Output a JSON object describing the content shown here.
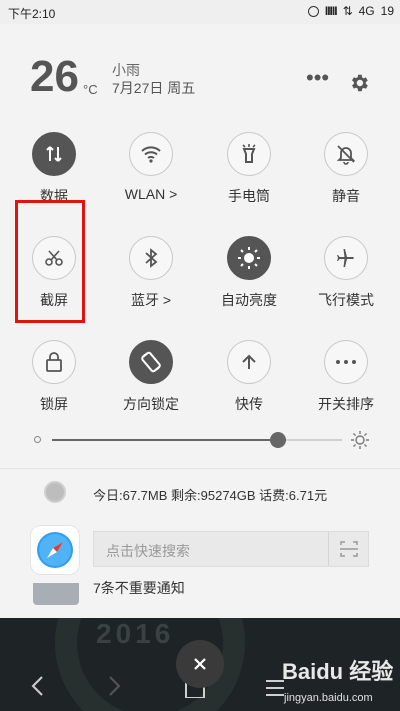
{
  "statusbar": {
    "time": "下午2:10",
    "network": "4G",
    "battery": "19"
  },
  "weather": {
    "temp": "26",
    "unit": "°C",
    "desc": "小雨",
    "date": "7月27日 周五"
  },
  "toggles": [
    {
      "label": "数据",
      "icon": "data-arrows-icon",
      "on": true
    },
    {
      "label": "WLAN >",
      "icon": "wifi-icon",
      "on": false
    },
    {
      "label": "手电筒",
      "icon": "flashlight-icon",
      "on": false
    },
    {
      "label": "静音",
      "icon": "bell-muted-icon",
      "on": false
    },
    {
      "label": "截屏",
      "icon": "scissors-icon",
      "on": false
    },
    {
      "label": "蓝牙 >",
      "icon": "bluetooth-icon",
      "on": false
    },
    {
      "label": "自动亮度",
      "icon": "auto-brightness-icon",
      "on": true
    },
    {
      "label": "飞行模式",
      "icon": "airplane-icon",
      "on": false
    },
    {
      "label": "锁屏",
      "icon": "lock-icon",
      "on": false
    },
    {
      "label": "方向锁定",
      "icon": "rotation-lock-icon",
      "on": true
    },
    {
      "label": "快传",
      "icon": "upload-arrow-icon",
      "on": false
    },
    {
      "label": "开关排序",
      "icon": "more-dots-icon",
      "on": false
    }
  ],
  "brightness": {
    "level": 0.78
  },
  "usage": {
    "text": "今日:67.7MB  剩余:95274GB  话费:6.71元"
  },
  "search": {
    "placeholder": "点击快速搜索"
  },
  "notification": {
    "text": "7条不重要通知"
  },
  "bottom": {
    "clock_text": "2016"
  },
  "watermark": {
    "brand": "Baidu 经验",
    "url": "jingyan.baidu.com"
  },
  "colors": {
    "highlight": "#e01313",
    "active": "#555555"
  }
}
